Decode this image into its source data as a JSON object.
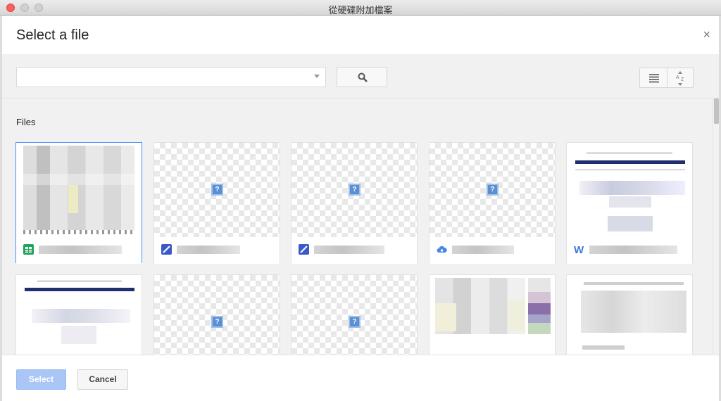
{
  "window": {
    "title": "從硬碟附加檔案"
  },
  "dialog": {
    "title": "Select a file",
    "close_glyph": "×"
  },
  "toolbar": {
    "search_value": "",
    "search_placeholder": ""
  },
  "content": {
    "section_label": "Files"
  },
  "files": [
    {
      "type": "spreadsheet",
      "preview": "document",
      "selected": true
    },
    {
      "type": "drawing",
      "preview": "unknown",
      "selected": false
    },
    {
      "type": "drawing",
      "preview": "unknown",
      "selected": false
    },
    {
      "type": "shared-drive",
      "preview": "unknown",
      "selected": false
    },
    {
      "type": "word",
      "preview": "document",
      "selected": false
    },
    {
      "type": "document",
      "preview": "document",
      "selected": false
    },
    {
      "type": "unknown",
      "preview": "unknown",
      "selected": false
    },
    {
      "type": "unknown",
      "preview": "unknown",
      "selected": false
    },
    {
      "type": "spreadsheet",
      "preview": "document",
      "selected": false
    },
    {
      "type": "document",
      "preview": "document",
      "selected": false
    }
  ],
  "footer": {
    "select_label": "Select",
    "cancel_label": "Cancel"
  },
  "colors": {
    "accent": "#4d90fe",
    "select_disabled": "#a9c6f7"
  }
}
